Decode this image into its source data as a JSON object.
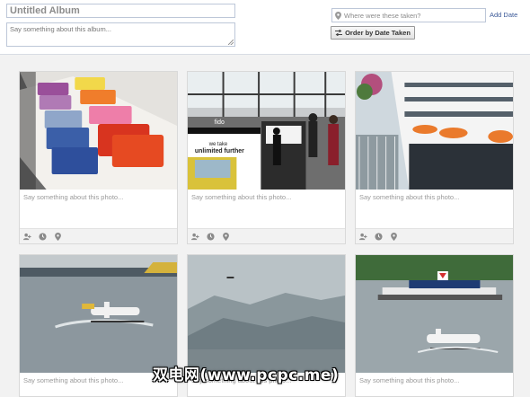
{
  "header": {
    "album_title_placeholder": "Untitled Album",
    "album_description_placeholder": "Say something about this album...",
    "location_placeholder": "Where were these taken?",
    "add_date_label": "Add Date",
    "order_button_label": "Order by Date Taken"
  },
  "photos": [
    {
      "scene": "folded-tshirts-on-table",
      "caption_placeholder": "Say something about this photo..."
    },
    {
      "scene": "fido-store-front",
      "caption_placeholder": "Say something about this photo..."
    },
    {
      "scene": "cruise-ship-side",
      "caption_placeholder": "Say something about this photo..."
    },
    {
      "scene": "seaplane-taking-off-harbour",
      "caption_placeholder": "Say something about this photo..."
    },
    {
      "scene": "misty-mountains-plane",
      "caption_placeholder": "Say something about this photo..."
    },
    {
      "scene": "chevron-barge-and-seaplane",
      "caption_placeholder": "Say something about this photo..."
    }
  ],
  "card_action_icons": [
    "tag-person-icon",
    "date-icon",
    "location-pin-icon"
  ],
  "photo_text": {
    "fido_sign": "fido",
    "fido_slogan_1": "we take",
    "fido_slogan_2": "unlimited further"
  },
  "watermark": "双电网(www.pcpc.me)",
  "colors": {
    "link": "#3b5998",
    "input_border": "#bdc7d8",
    "placeholder": "#8a8a8a",
    "grid_bg": "#f2f2f2"
  }
}
